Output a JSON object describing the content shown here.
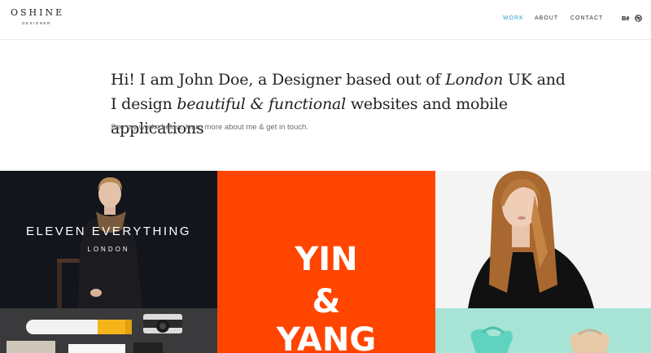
{
  "header": {
    "logo_main": "OSHINE",
    "logo_sub": "DESIGNER",
    "nav": [
      {
        "label": "WORK",
        "active": true
      },
      {
        "label": "ABOUT",
        "active": false
      },
      {
        "label": "CONTACT",
        "active": false
      }
    ],
    "socials": {
      "behance_label": "Bē",
      "dribbble_icon": "dribbble-icon"
    },
    "accent_color": "#2a9bc9"
  },
  "intro": {
    "heading_part1": "Hi! I am John Doe, a Designer based out of ",
    "heading_emph1": "London",
    "heading_part2": " UK and I design ",
    "heading_emph2": "beautiful & functional",
    "heading_part3": " websites and mobile applications",
    "subtext": "See my works below, learn more about me & get in touch."
  },
  "portfolio": {
    "tile1": {
      "title": "ELEVEN EVERYTHING",
      "subtitle": "LONDON",
      "bg": "#12151b"
    },
    "tile2": {
      "line1": "YIN",
      "line2": "&",
      "line3": "YANG",
      "bg": "#ff4500"
    },
    "tile3": {
      "bg": "#f3f3f3"
    },
    "tile4": {
      "bg": "#3a3a3c"
    },
    "tile5": {
      "bg": "#a8e4d6"
    }
  }
}
